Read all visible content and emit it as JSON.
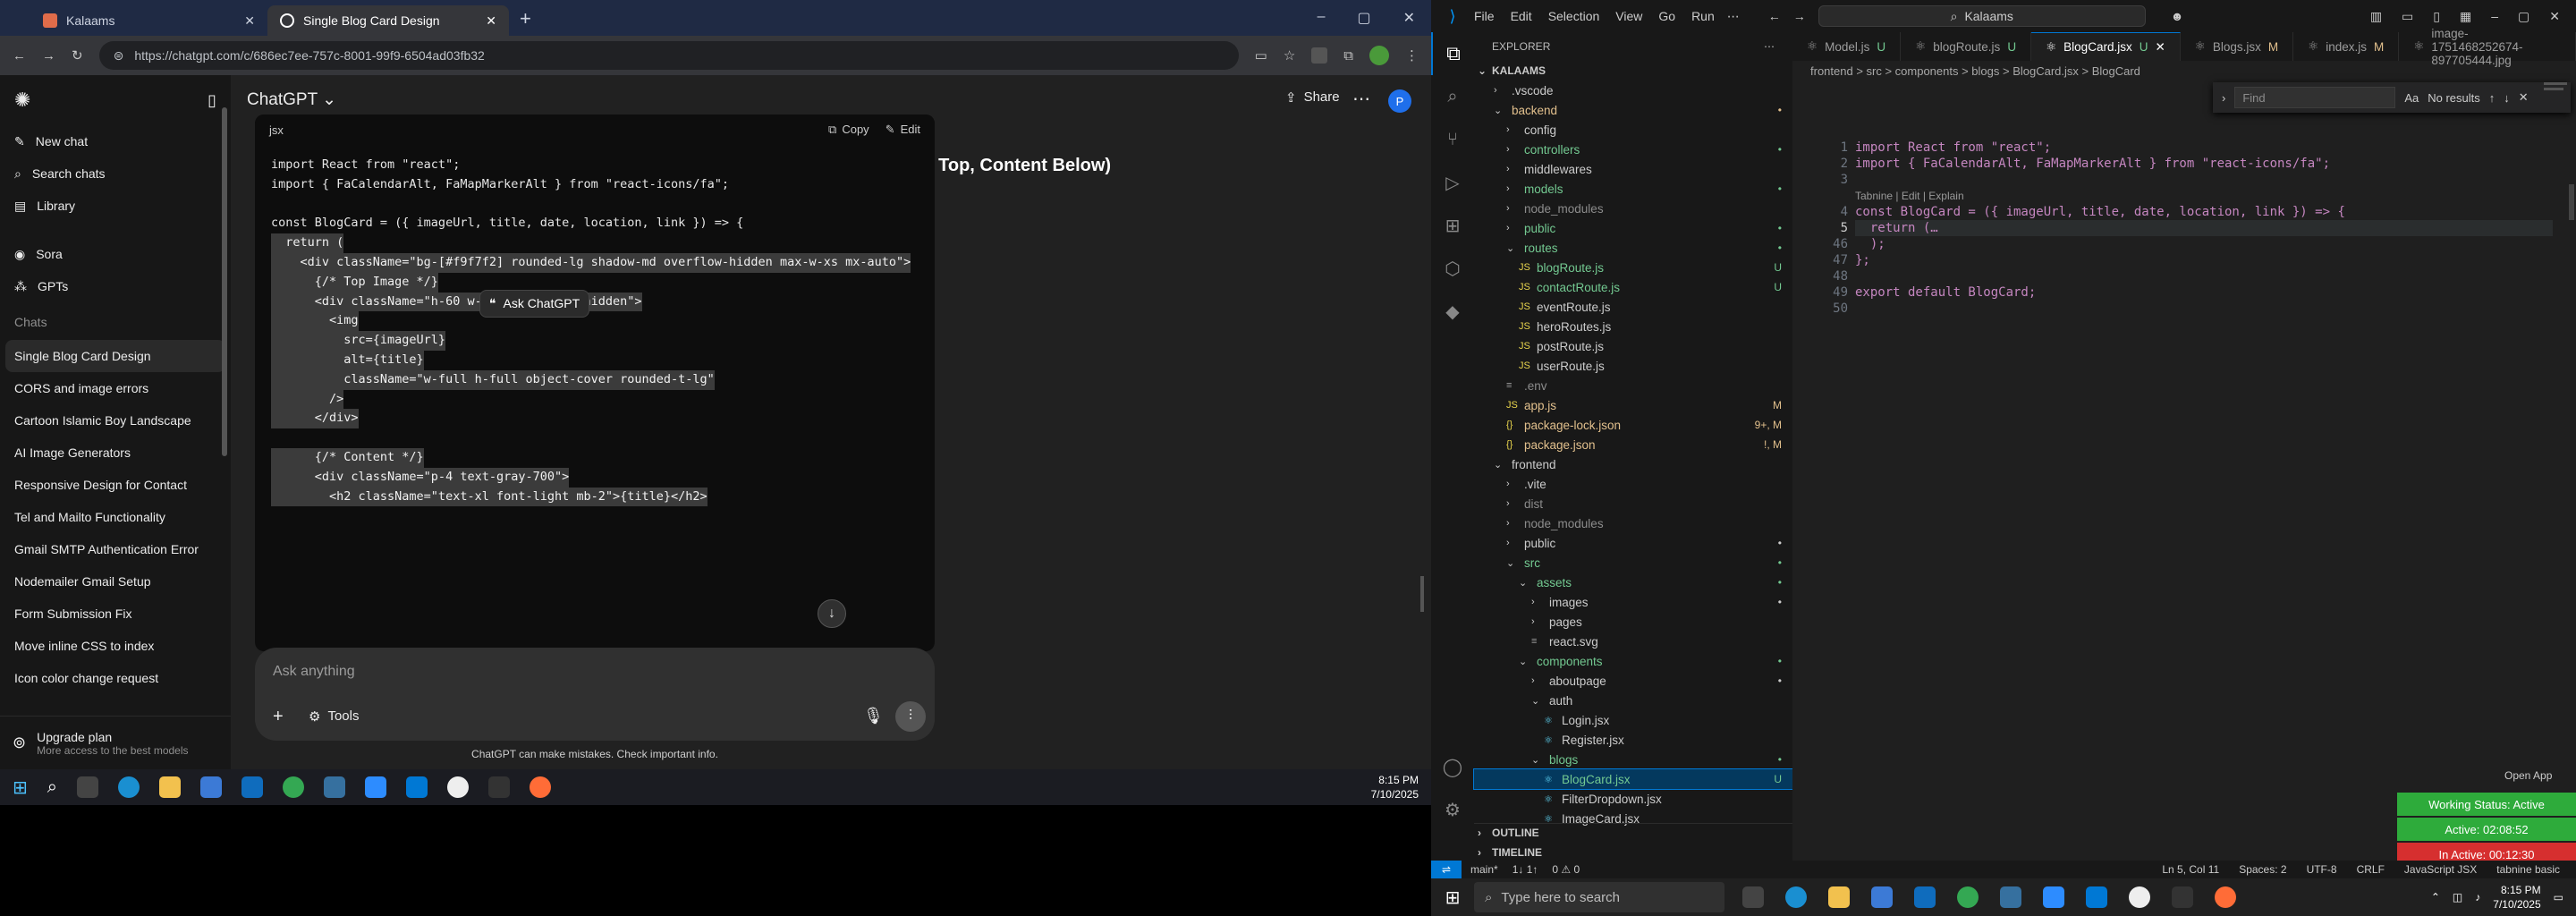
{
  "chrome": {
    "tab1": "Kalaams",
    "tab2": "Single Blog Card Design",
    "url": "https://chatgpt.com/c/686ec7ee-757c-8001-99f9-6504ad03fb32"
  },
  "sidebar": {
    "new_chat": "New chat",
    "search": "Search chats",
    "library": "Library",
    "sora": "Sora",
    "gpts": "GPTs",
    "chats_header": "Chats",
    "chats": [
      "Single Blog Card Design",
      "CORS and image errors",
      "Cartoon Islamic Boy Landscape",
      "AI Image Generators",
      "Responsive Design for Contact",
      "Tel and Mailto Functionality",
      "Gmail SMTP Authentication Error",
      "Nodemailer Gmail Setup",
      "Form Submission Fix",
      "Move inline CSS to index",
      "Icon color change request"
    ],
    "upgrade_title": "Upgrade plan",
    "upgrade_sub": "More access to the best models"
  },
  "chatgpt": {
    "model": "ChatGPT",
    "share": "Share",
    "heading": "Updated Tailwind + React Card Layout (Image on Top, Content Below)",
    "code_lang": "jsx",
    "copy": "Copy",
    "edit": "Edit",
    "ask_chatgpt": "Ask ChatGPT",
    "code_lines": [
      "import React from \"react\";",
      "import { FaCalendarAlt, FaMapMarkerAlt } from \"react-icons/fa\";",
      "",
      "const BlogCard = ({ imageUrl, title, date, location, link }) => {",
      "  return (",
      "    <div className=\"bg-[#f9f7f2] rounded-lg shadow-md overflow-hidden max-w-xs mx-auto\">",
      "      {/* Top Image */}",
      "      <div className=\"h-60 w-full overflow-hidden\">",
      "        <img",
      "          src={imageUrl}",
      "          alt={title}",
      "          className=\"w-full h-full object-cover rounded-t-lg\"",
      "        />",
      "      </div>",
      "",
      "      {/* Content */}",
      "      <div className=\"p-4 text-gray-700\">",
      "        <h2 className=\"text-xl font-light mb-2\">{title}</h2>"
    ],
    "composer_placeholder": "Ask anything",
    "tools": "Tools",
    "disclaimer": "ChatGPT can make mistakes. Check important info."
  },
  "taskbar_left": {
    "time": "8:15 PM",
    "date": "7/10/2025"
  },
  "vscode": {
    "menu": [
      "File",
      "Edit",
      "Selection",
      "View",
      "Go",
      "Run"
    ],
    "search": "Kalaams",
    "explorer_title": "EXPLORER",
    "project": "KALAAMS",
    "tree": [
      {
        "name": ".vscode",
        "indent": 1,
        "type": "folder",
        "color": "#cccccc",
        "dec": ""
      },
      {
        "name": "backend",
        "indent": 1,
        "type": "folder-open",
        "color": "#e2c08d",
        "dec": "•"
      },
      {
        "name": "config",
        "indent": 2,
        "type": "folder",
        "color": "#cccccc",
        "dec": ""
      },
      {
        "name": "controllers",
        "indent": 2,
        "type": "folder",
        "color": "#73c991",
        "dec": "•"
      },
      {
        "name": "middlewares",
        "indent": 2,
        "type": "folder",
        "color": "#cccccc",
        "dec": ""
      },
      {
        "name": "models",
        "indent": 2,
        "type": "folder",
        "color": "#73c991",
        "dec": "•"
      },
      {
        "name": "node_modules",
        "indent": 2,
        "type": "folder",
        "color": "#8c8c8c",
        "dec": ""
      },
      {
        "name": "public",
        "indent": 2,
        "type": "folder",
        "color": "#73c991",
        "dec": "•"
      },
      {
        "name": "routes",
        "indent": 2,
        "type": "folder-open",
        "color": "#73c991",
        "dec": "•"
      },
      {
        "name": "blogRoute.js",
        "indent": 3,
        "type": "js",
        "color": "#73c991",
        "dec": "U"
      },
      {
        "name": "contactRoute.js",
        "indent": 3,
        "type": "js",
        "color": "#73c991",
        "dec": "U"
      },
      {
        "name": "eventRoute.js",
        "indent": 3,
        "type": "js",
        "color": "#cccccc",
        "dec": ""
      },
      {
        "name": "heroRoutes.js",
        "indent": 3,
        "type": "js",
        "color": "#cccccc",
        "dec": ""
      },
      {
        "name": "postRoute.js",
        "indent": 3,
        "type": "js",
        "color": "#cccccc",
        "dec": ""
      },
      {
        "name": "userRoute.js",
        "indent": 3,
        "type": "js",
        "color": "#cccccc",
        "dec": ""
      },
      {
        "name": ".env",
        "indent": 2,
        "type": "file",
        "color": "#8c8c8c",
        "dec": ""
      },
      {
        "name": "app.js",
        "indent": 2,
        "type": "js",
        "color": "#e2c08d",
        "dec": "M"
      },
      {
        "name": "package-lock.json",
        "indent": 2,
        "type": "json",
        "color": "#e2c08d",
        "dec": "9+, M"
      },
      {
        "name": "package.json",
        "indent": 2,
        "type": "json",
        "color": "#e2c08d",
        "dec": "!, M"
      },
      {
        "name": "frontend",
        "indent": 1,
        "type": "folder-open",
        "color": "#cccccc",
        "dec": ""
      },
      {
        "name": ".vite",
        "indent": 2,
        "type": "folder",
        "color": "#cccccc",
        "dec": ""
      },
      {
        "name": "dist",
        "indent": 2,
        "type": "folder",
        "color": "#8c8c8c",
        "dec": ""
      },
      {
        "name": "node_modules",
        "indent": 2,
        "type": "folder",
        "color": "#8c8c8c",
        "dec": ""
      },
      {
        "name": "public",
        "indent": 2,
        "type": "folder",
        "color": "#cccccc",
        "dec": "•"
      },
      {
        "name": "src",
        "indent": 2,
        "type": "folder-open",
        "color": "#73c991",
        "dec": "•"
      },
      {
        "name": "assets",
        "indent": 3,
        "type": "folder-open",
        "color": "#73c991",
        "dec": "•"
      },
      {
        "name": "images",
        "indent": 4,
        "type": "folder",
        "color": "#cccccc",
        "dec": "•"
      },
      {
        "name": "pages",
        "indent": 4,
        "type": "folder",
        "color": "#cccccc",
        "dec": ""
      },
      {
        "name": "react.svg",
        "indent": 4,
        "type": "file",
        "color": "#cccccc",
        "dec": ""
      },
      {
        "name": "components",
        "indent": 3,
        "type": "folder-open",
        "color": "#73c991",
        "dec": "•"
      },
      {
        "name": "aboutpage",
        "indent": 4,
        "type": "folder",
        "color": "#cccccc",
        "dec": "•"
      },
      {
        "name": "auth",
        "indent": 4,
        "type": "folder-open",
        "color": "#cccccc",
        "dec": ""
      },
      {
        "name": "Login.jsx",
        "indent": 5,
        "type": "jsx",
        "color": "#cccccc",
        "dec": ""
      },
      {
        "name": "Register.jsx",
        "indent": 5,
        "type": "jsx",
        "color": "#cccccc",
        "dec": ""
      },
      {
        "name": "blogs",
        "indent": 4,
        "type": "folder-open",
        "color": "#73c991",
        "dec": "•"
      },
      {
        "name": "BlogCard.jsx",
        "indent": 5,
        "type": "jsx",
        "color": "#73c991",
        "dec": "U",
        "selected": true
      },
      {
        "name": "FilterDropdown.jsx",
        "indent": 5,
        "type": "jsx",
        "color": "#cccccc",
        "dec": ""
      },
      {
        "name": "ImageCard.jsx",
        "indent": 5,
        "type": "jsx",
        "color": "#cccccc",
        "dec": ""
      }
    ],
    "outline": "OUTLINE",
    "timeline": "TIMELINE",
    "tabs": [
      {
        "name": "Model.js",
        "dec": "U"
      },
      {
        "name": "blogRoute.js",
        "dec": "U"
      },
      {
        "name": "BlogCard.jsx",
        "dec": "U",
        "active": true
      },
      {
        "name": "Blogs.jsx",
        "dec": "M"
      },
      {
        "name": "index.js",
        "dec": "M"
      },
      {
        "name": "image-1751468252674-897705444.jpg",
        "dec": ""
      }
    ],
    "breadcrumb": "frontend > src > components > blogs > BlogCard.jsx > BlogCard",
    "find_placeholder": "Find",
    "find_result": "No results",
    "codelens": "Tabnine | Edit | Explain",
    "code": [
      {
        "n": "1",
        "text": "import React from \"react\";"
      },
      {
        "n": "2",
        "text": "import { FaCalendarAlt, FaMapMarkerAlt } from \"react-icons/fa\";"
      },
      {
        "n": "3",
        "text": ""
      },
      {
        "n": "4",
        "text": "const BlogCard = ({ imageUrl, title, date, location, link }) => {"
      },
      {
        "n": "5",
        "text": "  return (…"
      },
      {
        "n": "46",
        "text": "  );"
      },
      {
        "n": "47",
        "text": "};"
      },
      {
        "n": "48",
        "text": ""
      },
      {
        "n": "49",
        "text": "export default BlogCard;"
      },
      {
        "n": "50",
        "text": ""
      }
    ],
    "open_app": "Open App",
    "working_status": "Working Status: Active",
    "active_time": "Active: 02:08:52",
    "inactive_time": "In Active: 00:12:30",
    "status_left": [
      "main*",
      "1↓ 1↑",
      "0 ⚠ 0"
    ],
    "status_right": [
      "Ln 5, Col 11",
      "Spaces: 2",
      "UTF-8",
      "CRLF",
      "JavaScript JSX",
      "tabnine basic"
    ]
  },
  "windows_taskbar": {
    "search_placeholder": "Type here to search",
    "time": "8:15 PM",
    "date": "7/10/2025"
  }
}
